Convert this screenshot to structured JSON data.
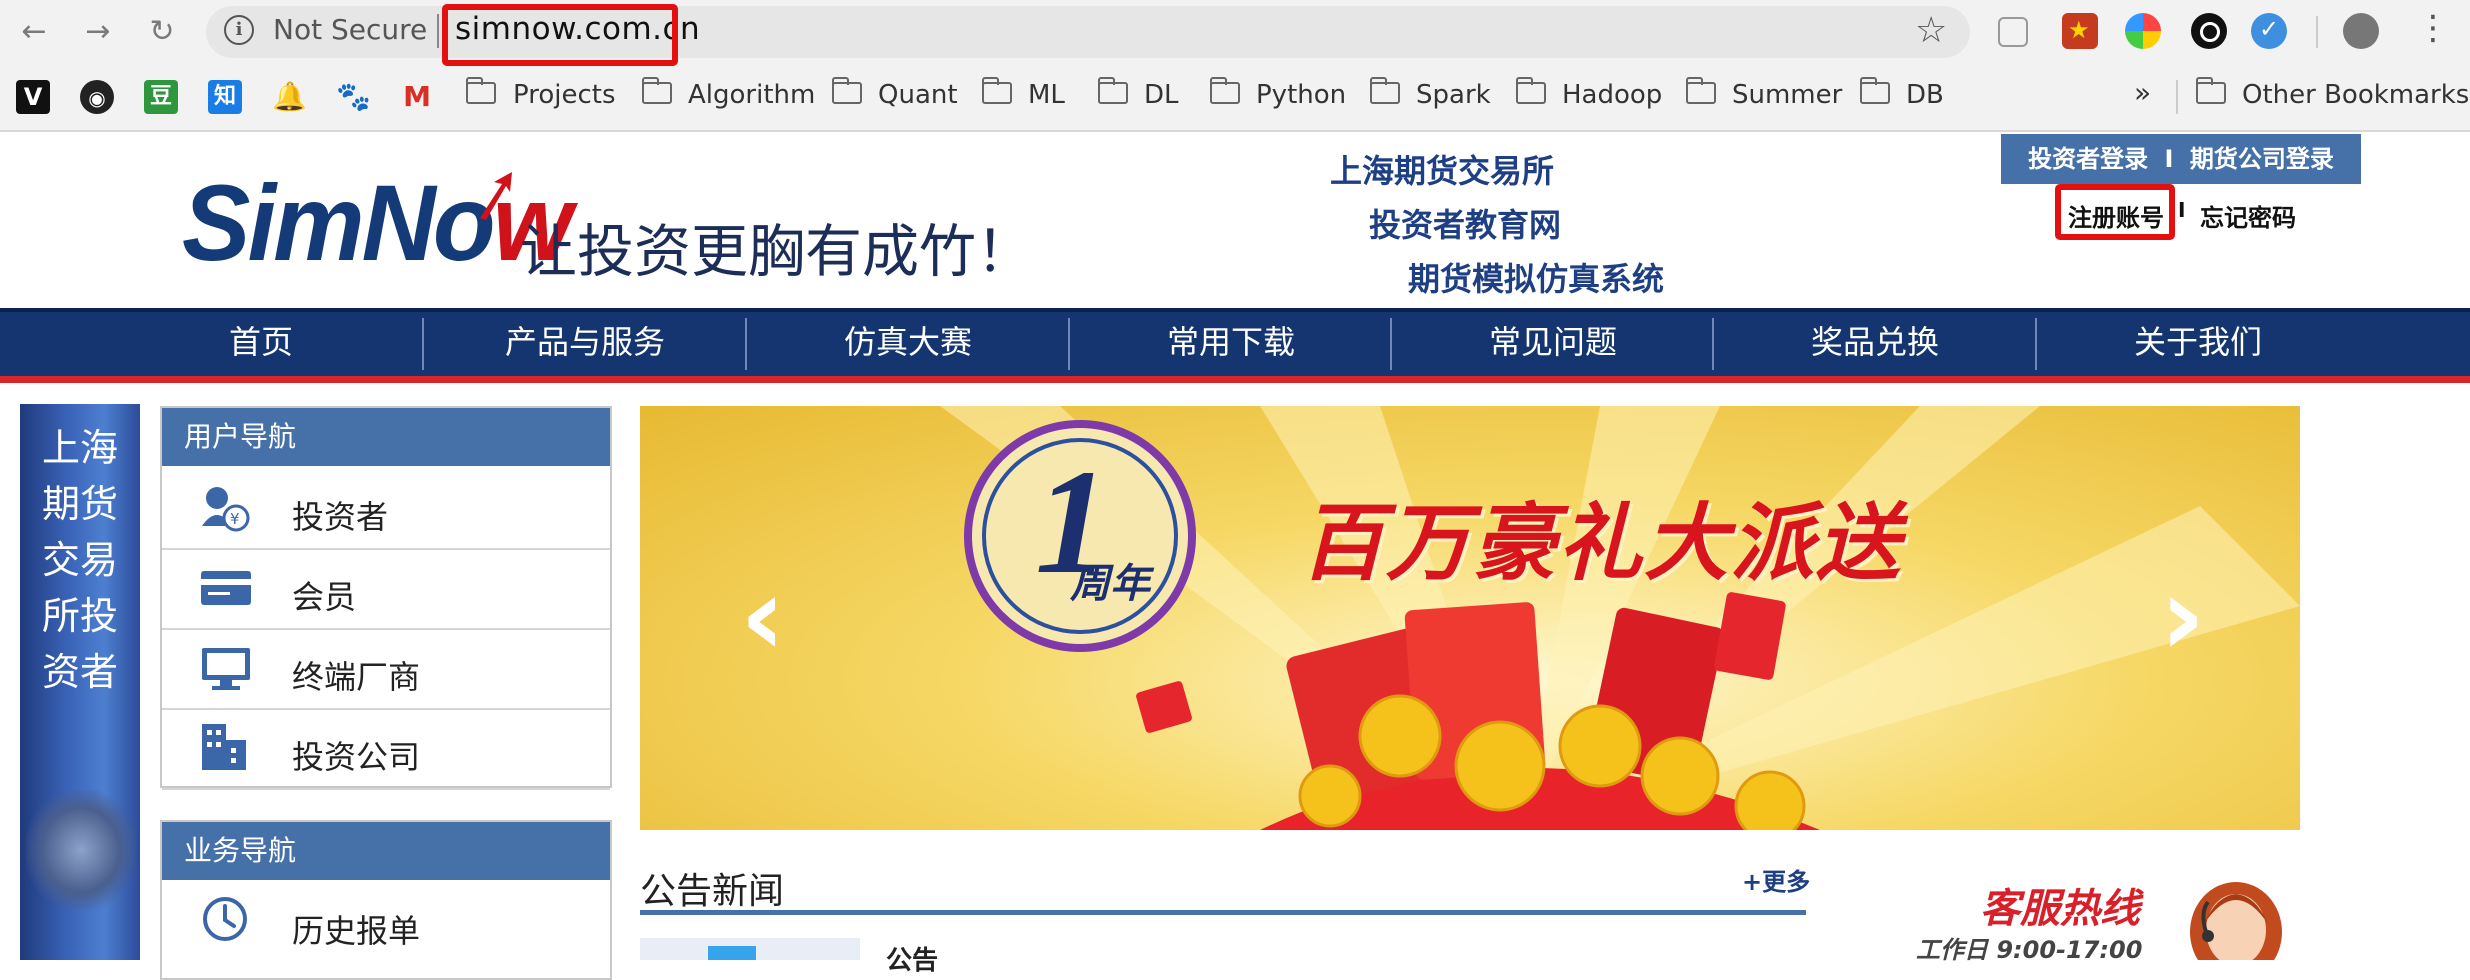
{
  "browser": {
    "security_label": "Not Secure",
    "url": "simnow.com.cn",
    "bookmarks": [
      "Projects",
      "Algorithm",
      "Quant",
      "ML",
      "DL",
      "Python",
      "Spark",
      "Hadoop",
      "Summer",
      "DB"
    ],
    "bookmark_icons": [
      "V",
      "github-icon",
      "豆",
      "知",
      "rocket-icon",
      "paw-icon",
      "M"
    ],
    "overflow": "»",
    "other_bookmarks": "Other Bookmarks"
  },
  "header": {
    "logo_main": "SimNo",
    "logo_accent": "w",
    "slogan": "让投资更胸有成竹！",
    "system_lines": [
      "上海期货交易所",
      "投资者教育网",
      "期货模拟仿真系统"
    ],
    "login": {
      "investor": "投资者登录",
      "separator": "I",
      "company": "期货公司登录",
      "register": "注册账号",
      "forgot": "忘记密码"
    }
  },
  "nav": [
    "首页",
    "产品与服务",
    "仿真大赛",
    "常用下载",
    "常见问题",
    "奖品兑换",
    "关于我们"
  ],
  "left_strip": "上海期货交易所投资者",
  "user_nav": {
    "title": "用户导航",
    "items": [
      {
        "label": "投资者",
        "icon": "investor-icon"
      },
      {
        "label": "会员",
        "icon": "card-icon"
      },
      {
        "label": "终端厂商",
        "icon": "monitor-icon"
      },
      {
        "label": "投资公司",
        "icon": "building-icon"
      }
    ]
  },
  "business_nav": {
    "title": "业务导航",
    "items": [
      {
        "label": "历史报单",
        "icon": "clock-icon"
      }
    ]
  },
  "banner": {
    "badge_number": "1",
    "badge_text": "周年",
    "headline": "百万豪礼大派送",
    "prev": "‹",
    "next": "›"
  },
  "news": {
    "title": "公告新闻",
    "more": "+更多",
    "first_item": "公告"
  },
  "service": {
    "title": "客服热线",
    "hours": "工作日 9:00-17:00"
  },
  "colors": {
    "nav_blue": "#14356f",
    "accent_red": "#d9262b",
    "box_blue": "#4670a8"
  }
}
